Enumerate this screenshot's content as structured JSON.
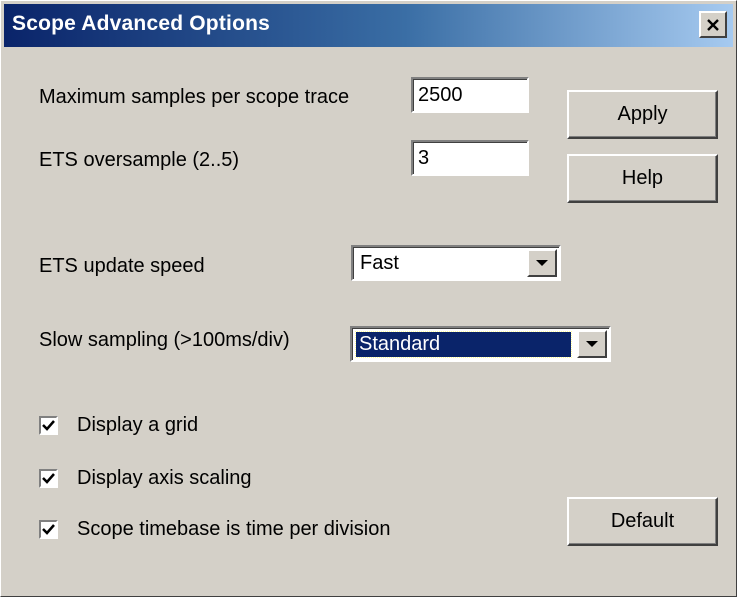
{
  "window": {
    "title": "Scope Advanced Options",
    "close_icon": "close-icon"
  },
  "fields": {
    "max_samples": {
      "label": "Maximum samples per scope trace",
      "value": "2500"
    },
    "ets_oversample": {
      "label": "ETS oversample (2..5)",
      "value": "3"
    },
    "ets_update_speed": {
      "label": "ETS update speed",
      "value": "Fast"
    },
    "slow_sampling": {
      "label": "Slow sampling (>100ms/div)",
      "value": "Standard"
    }
  },
  "checkboxes": {
    "display_grid": {
      "label": "Display a grid",
      "checked": true
    },
    "display_axis": {
      "label": "Display axis scaling",
      "checked": true
    },
    "timebase": {
      "label": "Scope timebase is time per division",
      "checked": true
    }
  },
  "buttons": {
    "apply": "Apply",
    "help": "Help",
    "default": "Default"
  }
}
